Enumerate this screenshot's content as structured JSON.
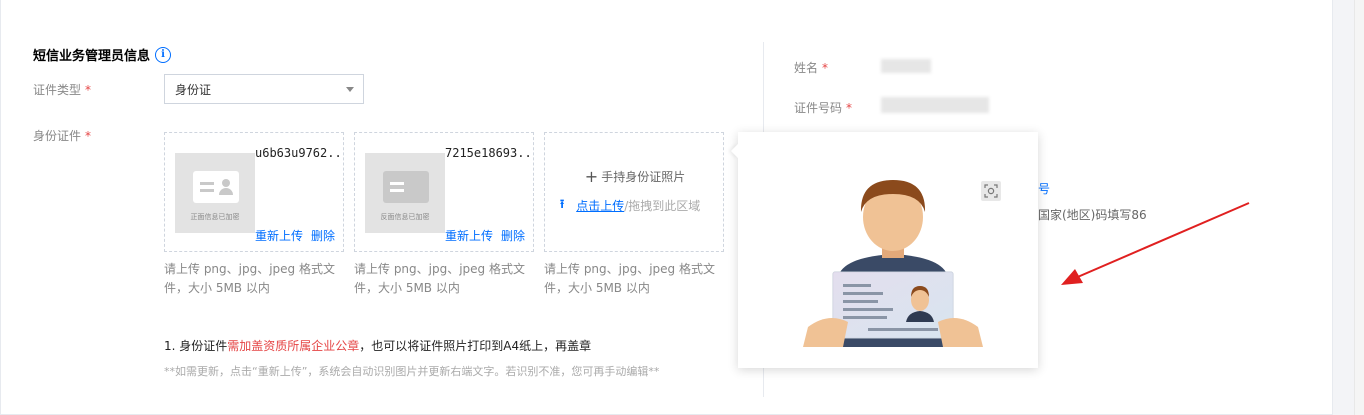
{
  "section": {
    "title": "短信业务管理员信息",
    "info_icon": "info-icon"
  },
  "form": {
    "cert_type_label": "证件类型",
    "cert_type_value": "身份证",
    "id_cert_label": "身份证件",
    "required_mark": "*"
  },
  "uploads": [
    {
      "filename": "u6b63u9762....",
      "thumb_caption": "正面信息已加密",
      "reupload": "重新上传",
      "delete": "删除",
      "hint": "请上传 png、jpg、jpeg 格式文件，大小 5MB 以内"
    },
    {
      "filename": "7215e18693....",
      "thumb_caption": "反面信息已加密",
      "reupload": "重新上传",
      "delete": "删除",
      "hint": "请上传 png、jpg、jpeg 格式文件，大小 5MB 以内"
    },
    {
      "title": "手持身份证照片",
      "click_upload": "点击上传",
      "drag_text": "/拖拽到此区域",
      "hint": "请上传 png、jpg、jpeg 格式文件，大小 5MB 以内"
    }
  ],
  "note": {
    "prefix": "1. 身份证件",
    "highlight": "需加盖资质所属企业公章",
    "suffix": "，也可以将证件照片打印到A4纸上，再盖章"
  },
  "note2": "**如需更新，点击“重新上传”，系统会自动识别图片并更新右端文字。若识别不准，您可再手动编辑**",
  "right": {
    "name_label": "姓名",
    "id_number_label": "证件号码",
    "partial_link": "号",
    "partial_text": "国家(地区)码填写86"
  },
  "colors": {
    "primary": "#006eff",
    "required": "#e54545",
    "annotation_arrow": "#e02020"
  }
}
